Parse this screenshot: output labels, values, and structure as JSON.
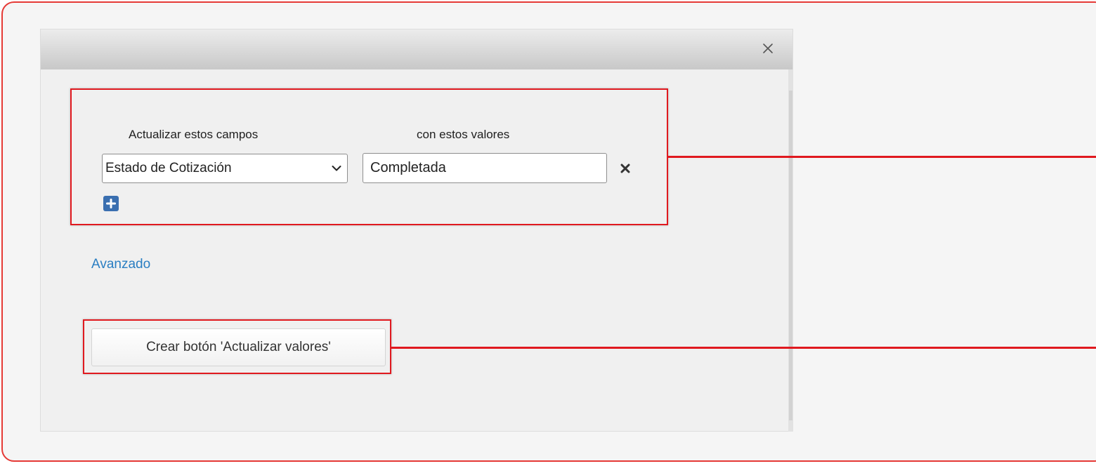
{
  "dialog": {
    "close_icon": "close-icon"
  },
  "update_fields": {
    "header_fields": "Actualizar estos campos",
    "header_values": "con estos valores",
    "rows": [
      {
        "field": "Estado de Cotización",
        "value": "Completada"
      }
    ],
    "add_icon": "plus-icon",
    "remove_icon": "close-icon"
  },
  "advanced_link": "Avanzado",
  "create_button_label": "Crear botón 'Actualizar valores'",
  "colors": {
    "highlight": "#e0191f",
    "link": "#2a7ec2",
    "add_button": "#3a6fb0"
  }
}
